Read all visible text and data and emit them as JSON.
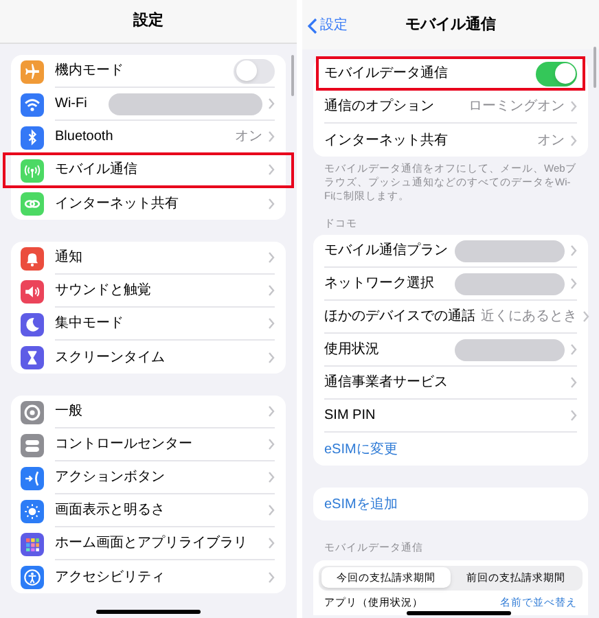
{
  "left": {
    "title": "設定",
    "groups": [
      [
        {
          "label": "機内モード",
          "kind": "toggle",
          "on": false,
          "color": "#f09a37",
          "highlighted": false
        },
        {
          "label": "Wi-Fi",
          "kind": "redacted",
          "color": "#3478f6",
          "highlighted": false
        },
        {
          "label": "Bluetooth",
          "kind": "value",
          "value": "オン",
          "color": "#3478f6",
          "highlighted": false
        },
        {
          "label": "モバイル通信",
          "kind": "plain",
          "color": "#4cd964",
          "highlighted": true
        },
        {
          "label": "インターネット共有",
          "kind": "plain",
          "color": "#4cd964",
          "highlighted": false
        }
      ],
      [
        {
          "label": "通知",
          "kind": "plain",
          "color": "#eb4d3d",
          "highlighted": false
        },
        {
          "label": "サウンドと触覚",
          "kind": "plain",
          "color": "#eb445a",
          "highlighted": false
        },
        {
          "label": "集中モード",
          "kind": "plain",
          "color": "#5e5ce6",
          "highlighted": false
        },
        {
          "label": "スクリーンタイム",
          "kind": "plain",
          "color": "#5e5ce6",
          "highlighted": false
        }
      ],
      [
        {
          "label": "一般",
          "kind": "plain",
          "color": "#8e8e93",
          "highlighted": false
        },
        {
          "label": "コントロールセンター",
          "kind": "plain",
          "color": "#8e8e93",
          "highlighted": false
        },
        {
          "label": "アクションボタン",
          "kind": "plain",
          "color": "#2c7cf6",
          "highlighted": false
        },
        {
          "label": "画面表示と明るさ",
          "kind": "plain",
          "color": "#2c7cf6",
          "highlighted": false
        },
        {
          "label": "ホーム画面とアプリライブラリ",
          "kind": "plain",
          "color": "#5e5ce6",
          "highlighted": false
        },
        {
          "label": "アクセシビリティ",
          "kind": "plain",
          "color": "#2c7cf6",
          "highlighted": false
        }
      ]
    ]
  },
  "right": {
    "back": "設定",
    "title": "モバイル通信",
    "group1": [
      {
        "label": "モバイルデータ通信",
        "kind": "toggle",
        "on": true,
        "highlighted": true
      },
      {
        "label": "通信のオプション",
        "kind": "value",
        "value": "ローミングオン",
        "highlighted": false
      },
      {
        "label": "インターネット共有",
        "kind": "value",
        "value": "オン",
        "highlighted": false
      }
    ],
    "footnote": "モバイルデータ通信をオフにして、メール、Webブラウズ、プッシュ通知などのすべてのデータをWi-Fiに制限します。",
    "carrier_header": "ドコモ",
    "group2": [
      {
        "label": "モバイル通信プラン",
        "kind": "redacted"
      },
      {
        "label": "ネットワーク選択",
        "kind": "redacted"
      },
      {
        "label": "ほかのデバイスでの通話",
        "kind": "value",
        "value": "近くにあるとき"
      },
      {
        "label": "使用状況",
        "kind": "redacted"
      },
      {
        "label": "通信事業者サービス",
        "kind": "plain"
      },
      {
        "label": "SIM PIN",
        "kind": "plain"
      },
      {
        "label": "eSIMに変更",
        "kind": "link"
      }
    ],
    "group3": [
      {
        "label": "eSIMを追加",
        "kind": "link"
      }
    ],
    "usage_header": "モバイルデータ通信",
    "segments": [
      {
        "label": "今回の支払請求期間",
        "selected": true
      },
      {
        "label": "前回の支払請求期間",
        "selected": false
      }
    ],
    "apps_row": {
      "label": "アプリ（使用状況）",
      "action": "名前で並べ替え"
    }
  }
}
